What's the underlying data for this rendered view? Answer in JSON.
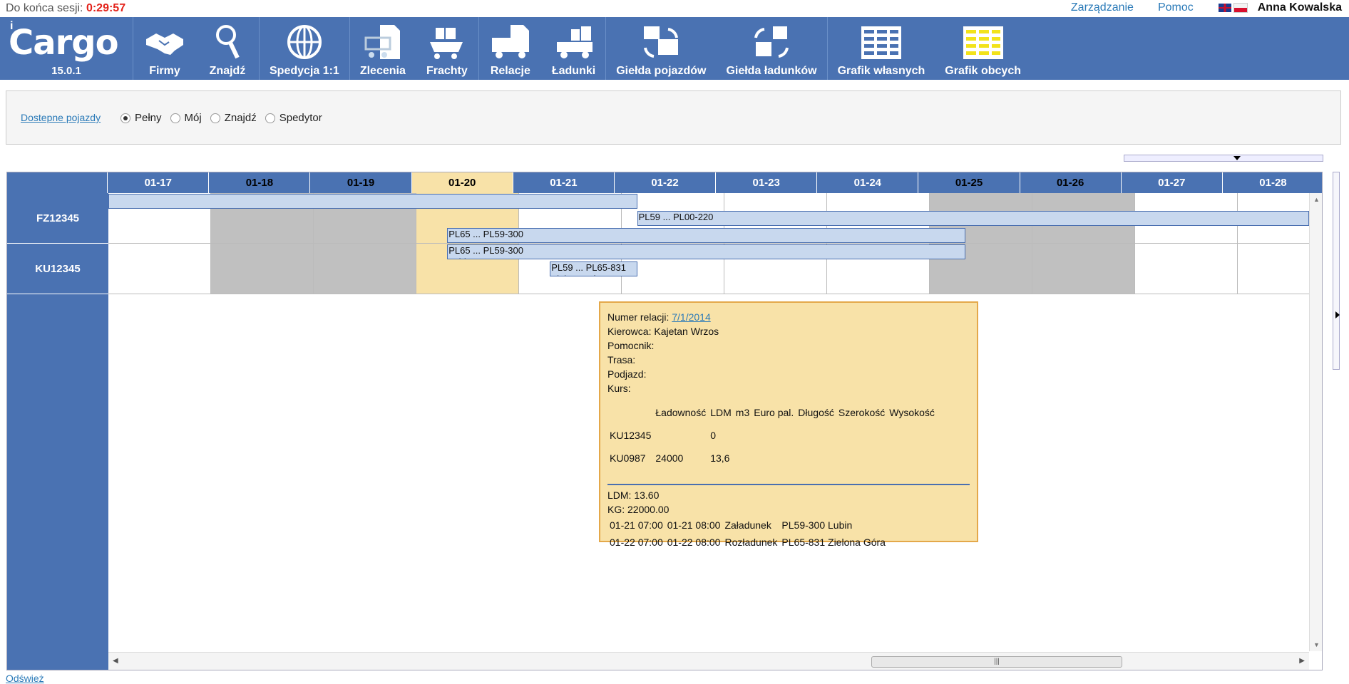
{
  "session": {
    "label": "Do końca sesji:",
    "time": "0:29:57"
  },
  "top_links": {
    "management": "Zarządzanie",
    "help": "Pomoc",
    "user": "Anna Kowalska"
  },
  "logo": {
    "text": "Cargo",
    "version": "15.0.1"
  },
  "toolbar": [
    {
      "label": "Firmy",
      "icon": "handshake-icon"
    },
    {
      "label": "Znajdź",
      "icon": "magnifier-icon"
    },
    {
      "label": "Spedycja 1:1",
      "icon": "globe-icon"
    },
    {
      "label": "Zlecenia",
      "icon": "cart-document-icon"
    },
    {
      "label": "Frachty",
      "icon": "cart-boxes-icon"
    },
    {
      "label": "Relacje",
      "icon": "truck-document-icon"
    },
    {
      "label": "Ładunki",
      "icon": "truck-boxes-icon"
    },
    {
      "label": "Giełda pojazdów",
      "icon": "vehicle-exchange-icon"
    },
    {
      "label": "Giełda ładunków",
      "icon": "cargo-exchange-icon"
    },
    {
      "label": "Grafik własnych",
      "icon": "schedule-own-icon"
    },
    {
      "label": "Grafik obcych",
      "icon": "schedule-foreign-icon"
    }
  ],
  "filter": {
    "link": "Dostepne pojazdy",
    "options": [
      {
        "label": "Pełny",
        "selected": true
      },
      {
        "label": "Mój",
        "selected": false
      },
      {
        "label": "Znajdź",
        "selected": false
      },
      {
        "label": "Spedytor",
        "selected": false
      }
    ]
  },
  "schedule": {
    "days": [
      "01-17",
      "01-18",
      "01-19",
      "01-20",
      "01-21",
      "01-22",
      "01-23",
      "01-24",
      "01-25",
      "01-26",
      "01-27",
      "01-28"
    ],
    "today": "01-20",
    "vehicles": [
      {
        "id": "FZ12345",
        "row_cells": [
          "w",
          "g",
          "g",
          "t",
          "w",
          "w",
          "w",
          "w",
          "g",
          "g",
          "w",
          "w"
        ]
      },
      {
        "id": "KU12345",
        "row_cells": [
          "w",
          "g",
          "g",
          "t",
          "w",
          "w",
          "w",
          "w",
          "g",
          "g",
          "w",
          "w"
        ]
      }
    ],
    "bars": [
      {
        "row": 0,
        "lane": 0,
        "start_day": 0,
        "end_day": 5.15,
        "text": "",
        "sub": ""
      },
      {
        "row": 0,
        "lane": 1,
        "start_day": 5.15,
        "end_day": 11.95,
        "text": "PL59 ... PL00-220",
        "sub": ""
      },
      {
        "row": 0,
        "lane": 2,
        "start_day": 3.3,
        "end_day": 8.35,
        "text": "PL65 ... PL59-300",
        "sub": ""
      },
      {
        "row": 1,
        "lane": 0,
        "start_day": 3.3,
        "end_day": 8.35,
        "text": "PL65 ... PL59-300",
        "sub": "Lubin"
      },
      {
        "row": 1,
        "lane": 1,
        "start_day": 4.3,
        "end_day": 5.15,
        "text": "PL59 ... PL65-831",
        "sub": "Zielona Góra"
      }
    ]
  },
  "tooltip": {
    "relation_label": "Numer relacji:",
    "relation_number": "7/1/2014",
    "driver": "Kierowca: Kajetan Wrzos",
    "assistant": "Pomocnik:",
    "route": "Trasa:",
    "approach": "Podjazd:",
    "course": "Kurs:",
    "columns": [
      "",
      "Ładowność",
      "LDM",
      "m3",
      "Euro pal.",
      "Długość",
      "Szerokość",
      "Wysokość"
    ],
    "rows": [
      [
        "KU12345",
        "",
        "0",
        "",
        "",
        "",
        "",
        ""
      ],
      [
        "KU0987",
        "24000",
        "13,6",
        "",
        "",
        "",
        "",
        ""
      ]
    ],
    "ldm": "LDM: 13.60",
    "kg": "KG: 22000.00",
    "stops": [
      [
        "01-21 07:00",
        "01-21 08:00",
        "Załadunek",
        "PL59-300 Lubin"
      ],
      [
        "01-22 07:00",
        "01-22 08:00",
        "Rozładunek",
        "PL65-831 Zielona Góra"
      ]
    ]
  },
  "refresh": "Odśwież",
  "colors": {
    "brand_blue": "#4a72b2",
    "session_red": "#e32119",
    "today": "#f8e2a8",
    "weekend": "#c0c0c0"
  }
}
